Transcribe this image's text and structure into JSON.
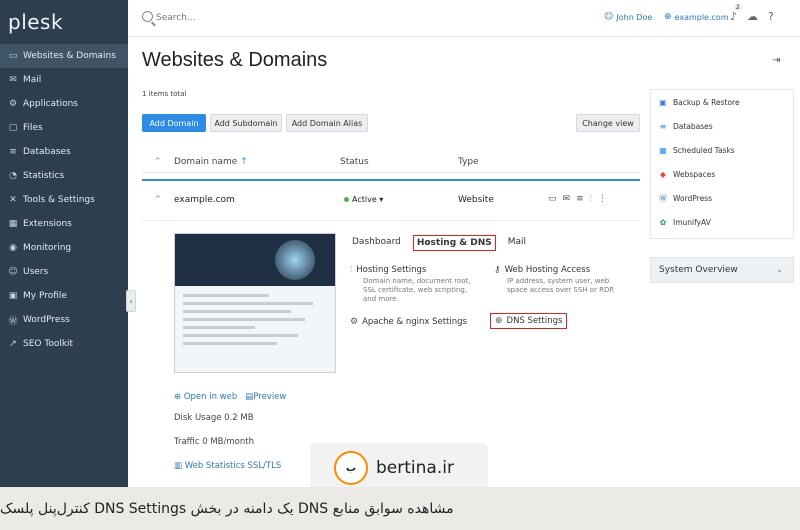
{
  "sidebar": {
    "logo": "plesk",
    "items": [
      {
        "label": "Websites & Domains",
        "icon": "monitor-icon"
      },
      {
        "label": "Mail",
        "icon": "mail-icon"
      },
      {
        "label": "Applications",
        "icon": "gear-icon"
      },
      {
        "label": "Files",
        "icon": "folder-icon"
      },
      {
        "label": "Databases",
        "icon": "database-icon"
      },
      {
        "label": "Statistics",
        "icon": "chart-icon"
      },
      {
        "label": "Tools & Settings",
        "icon": "tools-icon"
      },
      {
        "label": "Extensions",
        "icon": "puzzle-icon"
      },
      {
        "label": "Monitoring",
        "icon": "gauge-icon"
      },
      {
        "label": "Users",
        "icon": "user-icon"
      },
      {
        "label": "My Profile",
        "icon": "profile-icon"
      },
      {
        "label": "WordPress",
        "icon": "wordpress-icon"
      },
      {
        "label": "SEO Toolkit",
        "icon": "seo-icon"
      }
    ]
  },
  "topbar": {
    "search_placeholder": "Search...",
    "user": "John Doe",
    "domain": "example.com",
    "notifications_count": "2"
  },
  "main": {
    "title": "Websites & Domains",
    "items_total": "1 items total",
    "buttons": {
      "add_domain": "Add Domain",
      "add_subdomain": "Add Subdomain",
      "add_domain_alias": "Add Domain Alias",
      "change_view": "Change view"
    },
    "table": {
      "columns": [
        "Domain name",
        "Status",
        "Type"
      ],
      "sort_indicator": "↑",
      "row": {
        "domain": "example.com",
        "status": "Active",
        "type": "Website"
      }
    },
    "tabs": [
      "Dashboard",
      "Hosting & DNS",
      "Mail"
    ],
    "features": {
      "hosting_settings": {
        "title": "Hosting Settings",
        "desc": "Domain name, document root, SSL certificate, web scripting, and more."
      },
      "web_hosting_access": {
        "title": "Web Hosting Access",
        "desc": "IP address, system user, web space access over SSH or RDP."
      },
      "apache_nginx": {
        "title": "Apache & nginx Settings"
      },
      "dns_settings": {
        "title": "DNS Settings"
      }
    },
    "links": {
      "open_in_web": "Open in web",
      "preview": "Preview",
      "web_statistics": "Web Statistics SSL/TLS"
    },
    "stats": {
      "disk_usage": "Disk Usage 0.2 MB",
      "traffic": "Traffic 0 MB/month"
    }
  },
  "right_panel": {
    "items": [
      {
        "label": "Backup & Restore",
        "color": "#3a7bd5"
      },
      {
        "label": "Databases",
        "color": "#2c8be5"
      },
      {
        "label": "Scheduled Tasks",
        "color": "#2c8be5"
      },
      {
        "label": "Webspaces",
        "color": "#e0522a"
      },
      {
        "label": "WordPress",
        "color": "#2d77b8"
      },
      {
        "label": "ImunifyAV",
        "color": "#2e9e55"
      }
    ],
    "overview": "System Overview"
  },
  "watermark": {
    "text": "bertina.ir",
    "accent": "#ff8a00"
  },
  "caption": "مشاهده سوابق منابع DNS یک دامنه در بخش DNS Settings کنترل‌پنل پلسک"
}
